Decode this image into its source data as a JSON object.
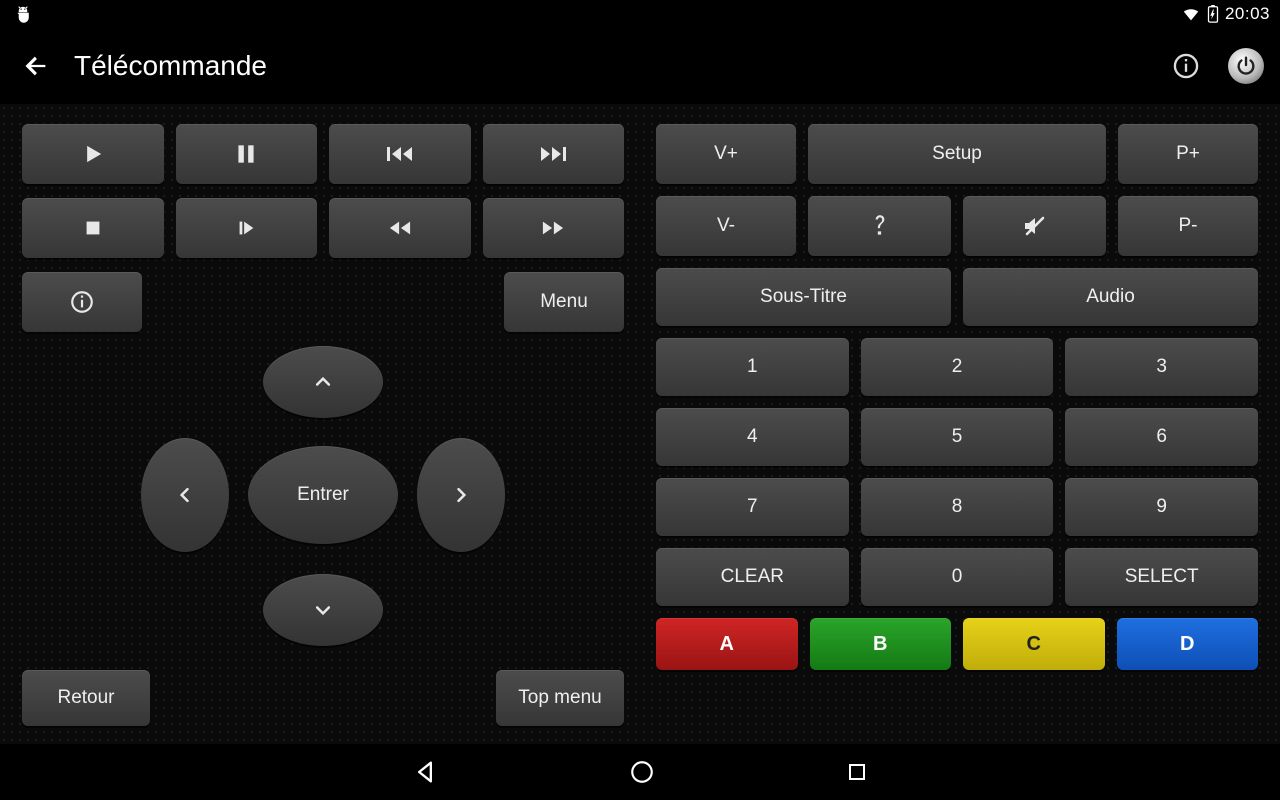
{
  "status": {
    "time": "20:03"
  },
  "header": {
    "title": "Télécommande"
  },
  "left": {
    "menu": "Menu",
    "enter": "Entrer",
    "retour": "Retour",
    "topmenu": "Top menu"
  },
  "right": {
    "vplus": "V+",
    "vminus": "V-",
    "setup": "Setup",
    "pplus": "P+",
    "pminus": "P-",
    "soustitre": "Sous-Titre",
    "audio": "Audio",
    "keys": [
      "1",
      "2",
      "3",
      "4",
      "5",
      "6",
      "7",
      "8",
      "9",
      "CLEAR",
      "0",
      "SELECT"
    ],
    "colors": {
      "a": "A",
      "b": "B",
      "c": "C",
      "d": "D"
    }
  }
}
